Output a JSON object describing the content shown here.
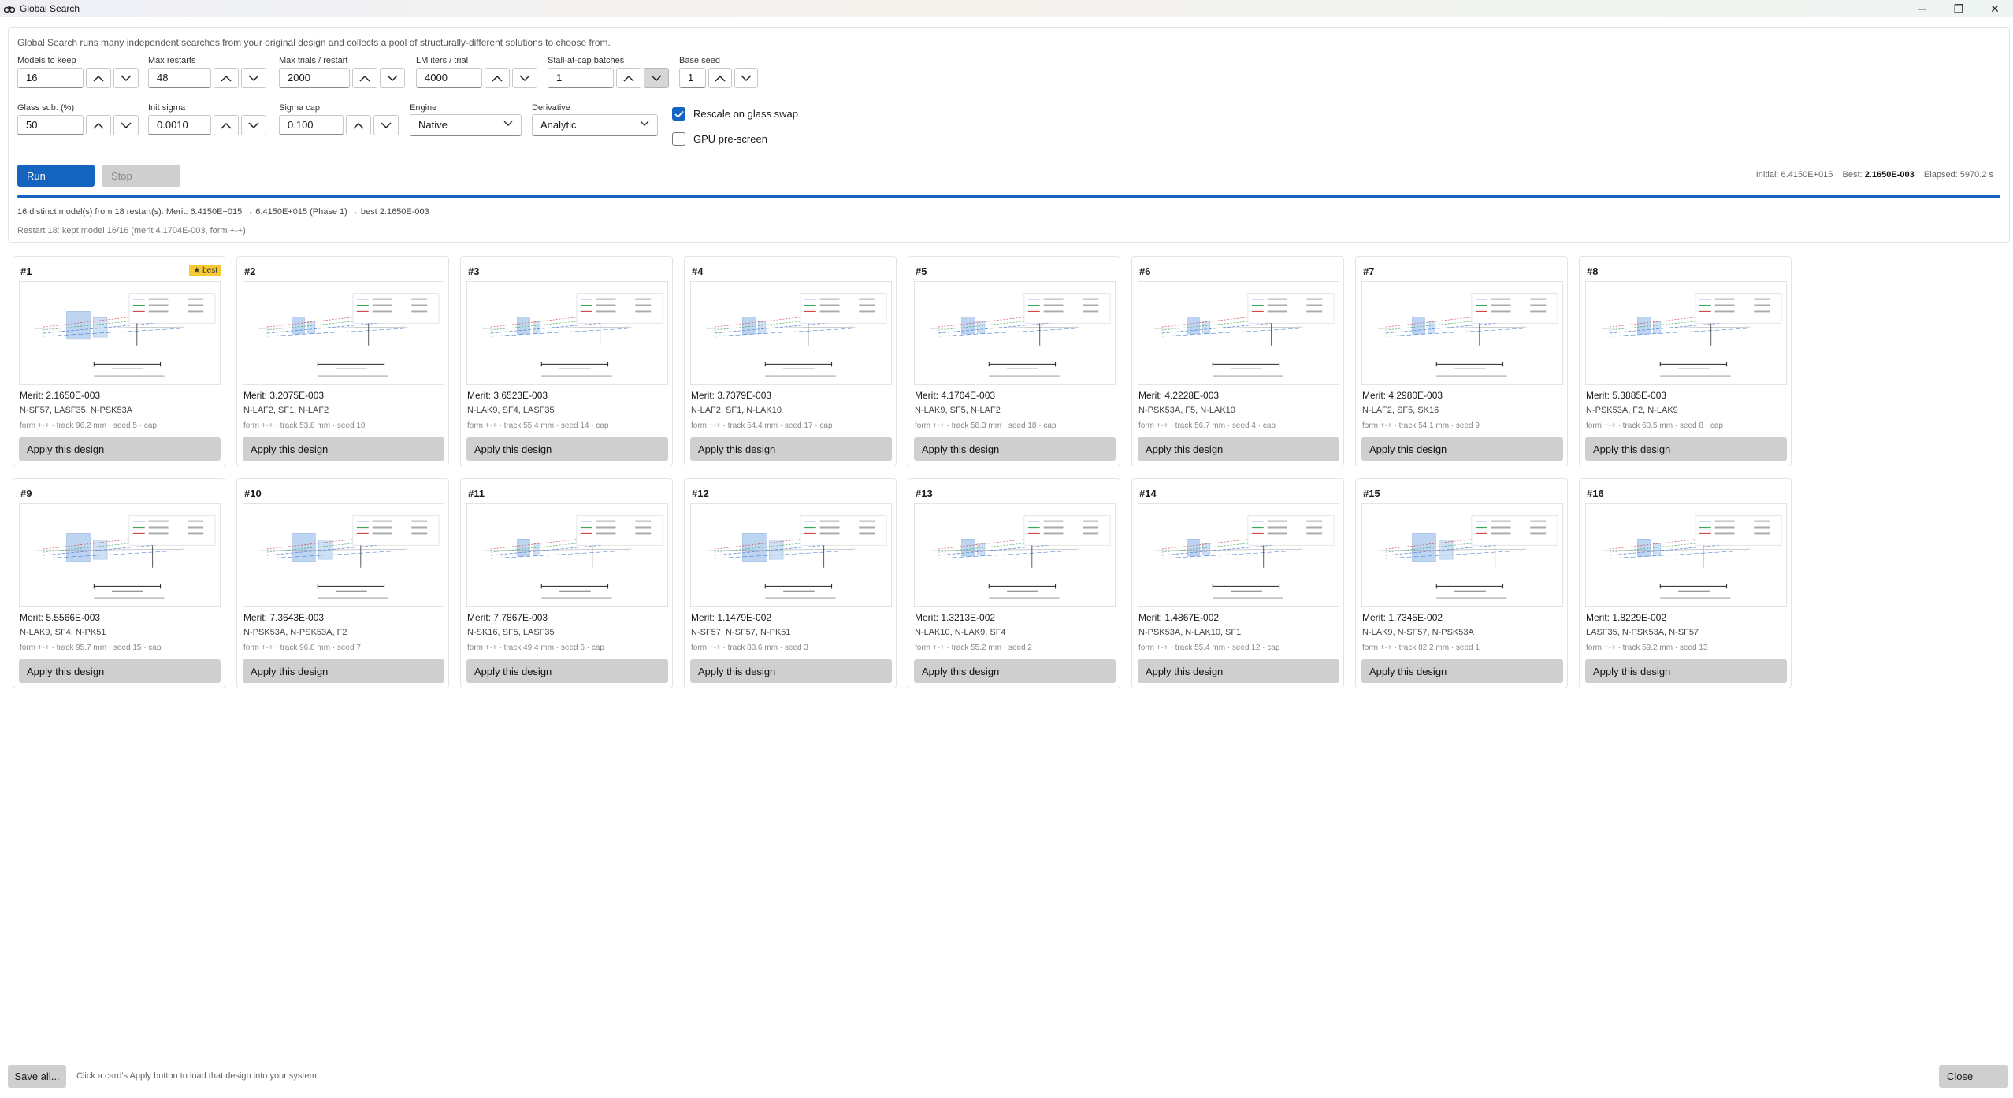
{
  "window": {
    "title": "Global Search",
    "app_icon": "binoculars-icon",
    "minimize": "─",
    "maximize": "❐",
    "close": "✕"
  },
  "settings": {
    "description": "Global Search runs many independent searches from your original design and collects a pool of structurally-different solutions to choose from.",
    "models_to_keep": {
      "label": "Models to keep",
      "value": "16"
    },
    "max_restarts": {
      "label": "Max restarts",
      "value": "48"
    },
    "max_trials": {
      "label": "Max trials / restart",
      "value": "2000"
    },
    "lm_iters": {
      "label": "LM iters / trial",
      "value": "4000"
    },
    "stall_batches": {
      "label": "Stall-at-cap batches",
      "value": "1"
    },
    "base_seed": {
      "label": "Base seed",
      "value": "1"
    },
    "glass_sub": {
      "label": "Glass sub. (%)",
      "value": "50"
    },
    "init_sigma": {
      "label": "Init sigma",
      "value": "0.0010"
    },
    "sigma_cap": {
      "label": "Sigma cap",
      "value": "0.100"
    },
    "engine": {
      "label": "Engine",
      "value": "Native"
    },
    "derivative": {
      "label": "Derivative",
      "value": "Analytic"
    },
    "rescale_on_glass_swap": {
      "label": "Rescale on glass swap",
      "checked": true
    },
    "gpu_prescreen": {
      "label": "GPU pre-screen",
      "checked": false
    }
  },
  "actions": {
    "run": "Run",
    "stop": "Stop"
  },
  "stats": {
    "initial_label": "Initial:",
    "initial_value": "6.4150E+015",
    "best_label": "Best:",
    "best_value": "2.1650E-003",
    "elapsed_label": "Elapsed:",
    "elapsed_value": "5970.2 s"
  },
  "progress": {
    "fraction": 1.0
  },
  "status": {
    "line1": "16 distinct model(s) from 18 restart(s). Merit: 6.4150E+015 → 6.4150E+015 (Phase 1) → best 2.1650E-003",
    "line2": "Restart 18: kept model 16/16 (merit 4.1704E-003, form +-+)"
  },
  "best_badge": "★ best",
  "apply_label": "Apply this design",
  "cards": [
    {
      "num": "#1",
      "merit": "Merit: 2.1650E-003",
      "glasses": "N-SF57, LASF35, N-PSK53A",
      "meta": "form +-+ · track 96.2 mm · seed 5 · cap"
    },
    {
      "num": "#2",
      "merit": "Merit: 3.2075E-003",
      "glasses": "N-LAF2, SF1, N-LAF2",
      "meta": "form +-+ · track 53.8 mm · seed 10"
    },
    {
      "num": "#3",
      "merit": "Merit: 3.6523E-003",
      "glasses": "N-LAK9, SF4, LASF35",
      "meta": "form +-+ · track 55.4 mm · seed 14 · cap"
    },
    {
      "num": "#4",
      "merit": "Merit: 3.7379E-003",
      "glasses": "N-LAF2, SF1, N-LAK10",
      "meta": "form +-+ · track 54.4 mm · seed 17 · cap"
    },
    {
      "num": "#5",
      "merit": "Merit: 4.1704E-003",
      "glasses": "N-LAK9, SF5, N-LAF2",
      "meta": "form +-+ · track 58.3 mm · seed 18 · cap"
    },
    {
      "num": "#6",
      "merit": "Merit: 4.2228E-003",
      "glasses": "N-PSK53A, F5, N-LAK10",
      "meta": "form +-+ · track 56.7 mm · seed 4 · cap"
    },
    {
      "num": "#7",
      "merit": "Merit: 4.2980E-003",
      "glasses": "N-LAF2, SF5, SK16",
      "meta": "form +-+ · track 54.1 mm · seed 9"
    },
    {
      "num": "#8",
      "merit": "Merit: 5.3885E-003",
      "glasses": "N-PSK53A, F2, N-LAK9",
      "meta": "form +-+ · track 60.5 mm · seed 8 · cap"
    },
    {
      "num": "#9",
      "merit": "Merit: 5.5566E-003",
      "glasses": "N-LAK9, SF4, N-PK51",
      "meta": "form +-+ · track 95.7 mm · seed 15 · cap"
    },
    {
      "num": "#10",
      "merit": "Merit: 7.3643E-003",
      "glasses": "N-PSK53A, N-PSK53A, F2",
      "meta": "form +-+ · track 96.8 mm · seed 7"
    },
    {
      "num": "#11",
      "merit": "Merit: 7.7867E-003",
      "glasses": "N-SK16, SF5, LASF35",
      "meta": "form +-+ · track 49.4 mm · seed 6 · cap"
    },
    {
      "num": "#12",
      "merit": "Merit: 1.1479E-002",
      "glasses": "N-SF57, N-SF57, N-PK51",
      "meta": "form +-+ · track 80.6 mm · seed 3"
    },
    {
      "num": "#13",
      "merit": "Merit: 1.3213E-002",
      "glasses": "N-LAK10, N-LAK9, SF4",
      "meta": "form +-+ · track 55.2 mm · seed 2"
    },
    {
      "num": "#14",
      "merit": "Merit: 1.4867E-002",
      "glasses": "N-PSK53A, N-LAK10, SF1",
      "meta": "form +-+ · track 55.4 mm · seed 12 · cap"
    },
    {
      "num": "#15",
      "merit": "Merit: 1.7345E-002",
      "glasses": "N-LAK9, N-SF57, N-PSK53A",
      "meta": "form +-+ · track 82.2 mm · seed 1"
    },
    {
      "num": "#16",
      "merit": "Merit: 1.8229E-002",
      "glasses": "LASF35, N-PSK53A, N-SF57",
      "meta": "form +-+ · track 59.2 mm · seed 13"
    }
  ],
  "footer": {
    "save_all": "Save all...",
    "hint": "Click a card's Apply button to load that design into your system.",
    "close": "Close"
  },
  "colors": {
    "accent": "#1565c0",
    "badge": "#f7c934",
    "button_gray": "#cfcfcf"
  }
}
